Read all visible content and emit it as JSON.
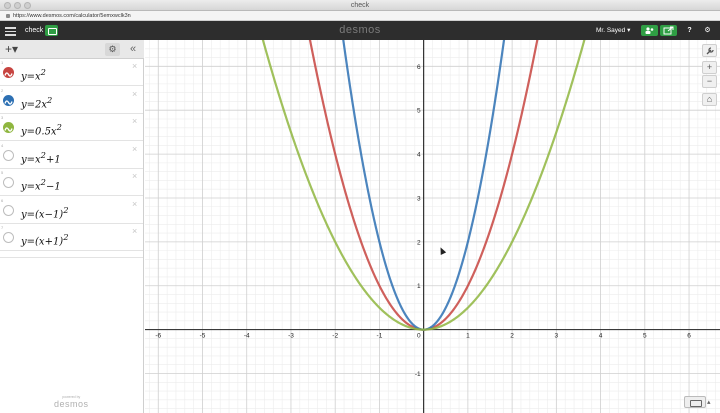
{
  "window": {
    "title": "check",
    "url": "https://www.desmos.com/calculator/5emxwclk3n"
  },
  "header": {
    "graph_title": "check",
    "brand": "desmos",
    "user": "Mr. Sayed ▾",
    "help_icon": "?",
    "language_icon": "⚙"
  },
  "sidebar": {
    "add_label": "+▾",
    "gear_icon": "⚙",
    "collapse_icon": "«",
    "expressions": [
      {
        "index": "1",
        "latex_html": "y=x<sup>2</sup>",
        "color": "#c74440",
        "active": true
      },
      {
        "index": "2",
        "latex_html": "y=2x<sup>2</sup>",
        "color": "#2d70b3",
        "active": true
      },
      {
        "index": "3",
        "latex_html": "y=0.5x<sup>2</sup>",
        "color": "#8fb63f",
        "active": true
      },
      {
        "index": "4",
        "latex_html": "y=x<sup>2</sup>+1",
        "color": "#bdbdbd",
        "active": false
      },
      {
        "index": "5",
        "latex_html": "y=x<sup>2</sup>−1",
        "color": "#bdbdbd",
        "active": false
      },
      {
        "index": "6",
        "latex_html": "y=(x−1)<sup>2</sup>",
        "color": "#bdbdbd",
        "active": false
      },
      {
        "index": "7",
        "latex_html": "y=(x+1)<sup>2</sup>",
        "color": "#bdbdbd",
        "active": false
      }
    ],
    "powered_label": "powered by",
    "powered_brand": "desmos"
  },
  "graph": {
    "x_range": [
      -6.3,
      6.7
    ],
    "y_range": [
      -1.9,
      6.6
    ],
    "x_ticks": [
      -6,
      -5,
      -4,
      -3,
      -2,
      -1,
      1,
      2,
      3,
      4,
      5,
      6
    ],
    "y_ticks": [
      -1,
      1,
      2,
      3,
      4,
      5,
      6
    ],
    "origin_label": "0",
    "curves": [
      {
        "name": "y=x^2",
        "coeff": 1,
        "color": "#c74440"
      },
      {
        "name": "y=2x^2",
        "coeff": 2,
        "color": "#2d70b3"
      },
      {
        "name": "y=0.5x^2",
        "coeff": 0.5,
        "color": "#8fb63f"
      }
    ]
  },
  "tools": {
    "wrench_icon": "🔧",
    "zoom_in": "+",
    "zoom_out": "−",
    "home_icon": "⌂"
  }
}
